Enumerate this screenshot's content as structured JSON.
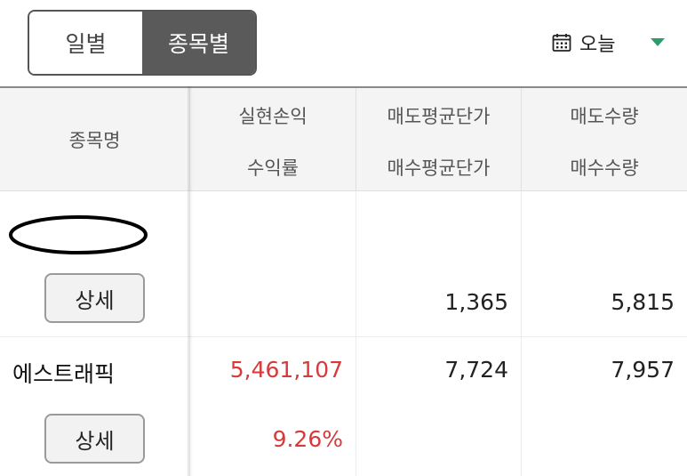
{
  "segmented": {
    "tabs": [
      {
        "label": "일별",
        "active": false
      },
      {
        "label": "종목별",
        "active": true
      }
    ]
  },
  "date_select": {
    "icon": "calendar-icon",
    "label": "오늘",
    "caret_icon": "caret-down-icon"
  },
  "table": {
    "headers": {
      "name": "종목명",
      "col2": {
        "line1": "실현손익",
        "line2": "수익률"
      },
      "col3": {
        "line1": "매도평균단가",
        "line2": "매수평균단가"
      },
      "col4": {
        "line1": "매도수량",
        "line2": "매수수량"
      }
    },
    "rows": [
      {
        "name": "",
        "name_redacted": true,
        "detail_label": "상세",
        "realized_pnl": "",
        "return_rate": "",
        "sell_avg_price": "1,365",
        "buy_avg_price": "",
        "sell_qty": "5,815",
        "buy_qty": ""
      },
      {
        "name": "에스트래픽",
        "name_redacted": false,
        "detail_label": "상세",
        "realized_pnl": "5,461,107",
        "return_rate": "9.26%",
        "sell_avg_price": "7,724",
        "buy_avg_price": "",
        "sell_qty": "7,957",
        "buy_qty": ""
      }
    ]
  },
  "colors": {
    "active_tab_bg": "#5a5a5a",
    "profit_red": "#d63a3a",
    "caret_green": "#2a9d6a",
    "header_bg": "#f4f4f4"
  }
}
